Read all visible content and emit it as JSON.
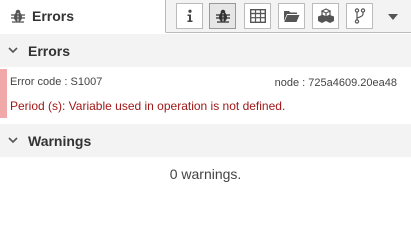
{
  "tabs": {
    "active_label": "Errors",
    "active_icon": "bug-icon",
    "buttons": [
      {
        "name": "info",
        "icon": "info-icon"
      },
      {
        "name": "errors",
        "icon": "bug-icon",
        "selected": true
      },
      {
        "name": "table",
        "icon": "table-icon"
      },
      {
        "name": "folder",
        "icon": "folder-open-icon"
      },
      {
        "name": "packages",
        "icon": "cubes-icon"
      },
      {
        "name": "git",
        "icon": "branch-icon"
      }
    ],
    "menu_icon": "caret-down-icon"
  },
  "errors_section": {
    "title": "Errors",
    "items": [
      {
        "code": "Error code : S1007",
        "node": "node : 725a4609.20ea48",
        "message": "Period (s): Variable used in operation is not defined.",
        "accent_color": "#f0a8a8"
      }
    ]
  },
  "warnings_section": {
    "title": "Warnings",
    "empty_message": "0 warnings."
  }
}
